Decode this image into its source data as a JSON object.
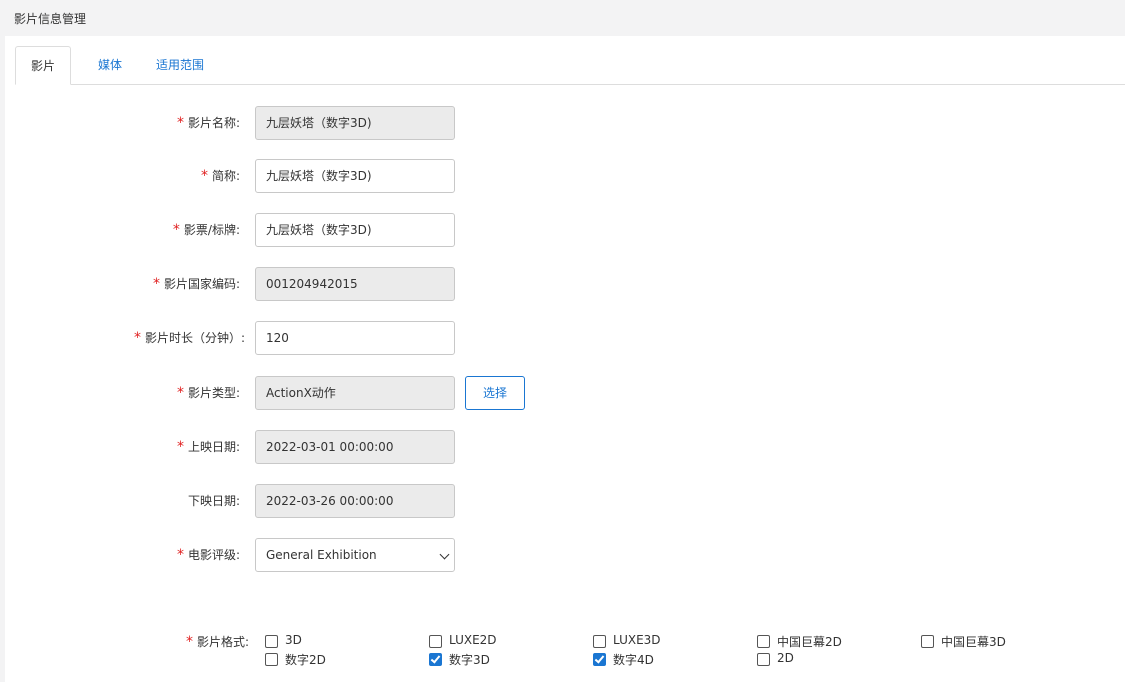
{
  "page": {
    "title": "影片信息管理"
  },
  "tabs": [
    {
      "label": "影片",
      "active": true
    },
    {
      "label": "媒体",
      "active": false
    },
    {
      "label": "适用范围",
      "active": false
    }
  ],
  "form": {
    "required_mark": "*",
    "film_name": {
      "label": "影片名称:",
      "value": "九层妖塔（数字3D)",
      "required": true,
      "disabled": true
    },
    "short_name": {
      "label": "简称:",
      "value": "九层妖塔（数字3D)",
      "required": true,
      "disabled": false
    },
    "ticket_label": {
      "label": "影票/标牌:",
      "value": "九层妖塔（数字3D)",
      "required": true,
      "disabled": false
    },
    "national_code": {
      "label": "影片国家编码:",
      "value": "001204942015",
      "required": true,
      "disabled": true
    },
    "duration": {
      "label": "影片时长（分钟）:",
      "value": "120",
      "required": true,
      "disabled": false
    },
    "film_type": {
      "label": "影片类型:",
      "value": "ActionX动作",
      "required": true,
      "disabled": true,
      "button": "选择"
    },
    "release_date": {
      "label": "上映日期:",
      "value": "2022-03-01 00:00:00",
      "required": true,
      "disabled": true
    },
    "offline_date": {
      "label": "下映日期:",
      "value": "2022-03-26 00:00:00",
      "required": false,
      "disabled": true
    },
    "rating": {
      "label": "电影评级:",
      "value": "General Exhibition",
      "required": true
    },
    "formats": {
      "label": "影片格式:",
      "options": [
        {
          "label": "3D",
          "checked": false
        },
        {
          "label": "LUXE2D",
          "checked": false
        },
        {
          "label": "LUXE3D",
          "checked": false
        },
        {
          "label": "中国巨幕2D",
          "checked": false
        },
        {
          "label": "中国巨幕3D",
          "checked": false
        },
        {
          "label": "数字2D",
          "checked": false
        },
        {
          "label": "数字3D",
          "checked": true
        },
        {
          "label": "数字4D",
          "checked": true
        },
        {
          "label": "2D",
          "checked": false
        }
      ]
    }
  },
  "colors": {
    "accent": "#1a76d2",
    "required": "#e02020",
    "disabled_bg": "#ebebeb"
  }
}
